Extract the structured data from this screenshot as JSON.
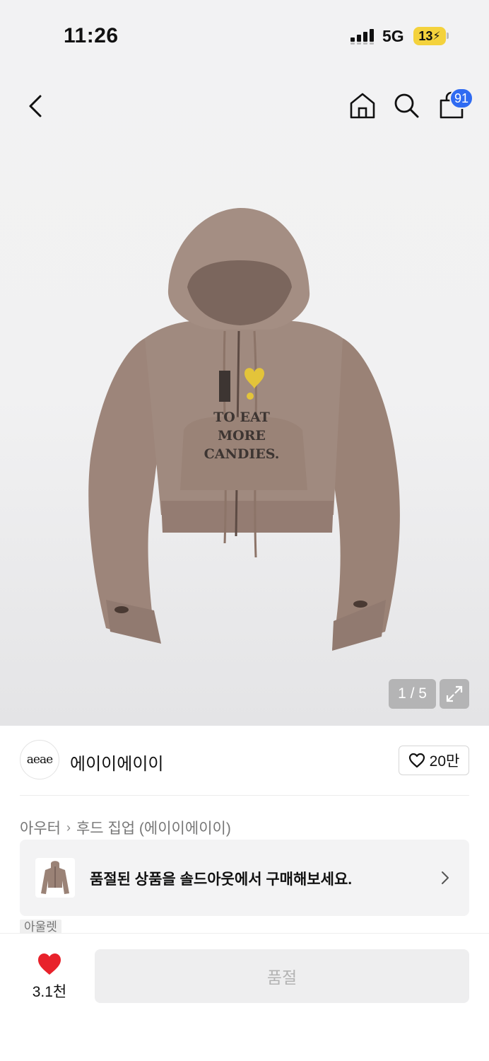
{
  "status_bar": {
    "time": "11:26",
    "network": "5G",
    "battery": "13"
  },
  "header": {
    "cart_count": "91",
    "icons": [
      "back-icon",
      "home-icon",
      "search-icon",
      "cart-icon"
    ]
  },
  "gallery": {
    "pager": "1 / 5"
  },
  "brand": {
    "logo_text": "aeae",
    "name": "에이이에이이",
    "like_count": "20만"
  },
  "breadcrumb": {
    "category": "아우터",
    "subcategory": "후드 집업 (에이이에이이)"
  },
  "soldout_banner": {
    "text": "품절된 상품을 솔드아웃에서 구매해보세요."
  },
  "tag": "아울렛",
  "bottom_bar": {
    "wish_count": "3.1천",
    "buy_label": "품절"
  },
  "colors": {
    "accent_blue": "#2f6bf2",
    "heart_red": "#e8222b",
    "battery_yellow": "#f4d23c",
    "hoodie": "#9a8276"
  }
}
